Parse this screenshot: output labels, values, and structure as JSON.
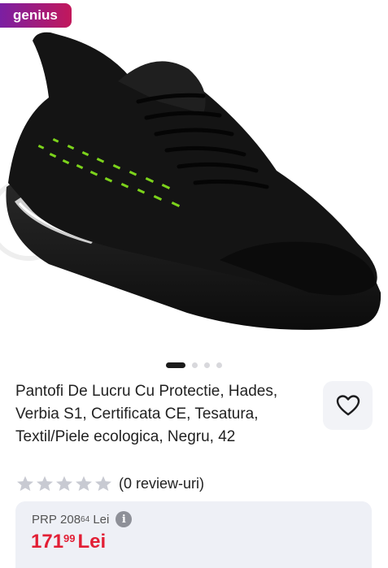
{
  "badge": {
    "label": "genius"
  },
  "product": {
    "title": "Pantofi De Lucru Cu Protectie, Hades, Verbia S1, Certificata CE, Tesatura, Textil/Piele ecologica, Negru, 42",
    "image_icon": "shoe-image"
  },
  "carousel": {
    "total": 4,
    "active": 0
  },
  "rating": {
    "stars": 0,
    "max": 5,
    "reviews_label": "(0 review-uri)"
  },
  "pricing": {
    "prp_label": "PRP",
    "prp_int": "208",
    "prp_dec": "64",
    "prp_currency": "Lei",
    "price_int": "171",
    "price_dec": "99",
    "price_currency": "Lei"
  },
  "colors": {
    "price": "#e21f35",
    "badge_start": "#7b1fa2",
    "badge_end": "#c2185b",
    "accent_green": "#7cd31b"
  },
  "icons": {
    "favorite": "heart-icon",
    "info": "info-icon",
    "star": "star-icon"
  }
}
